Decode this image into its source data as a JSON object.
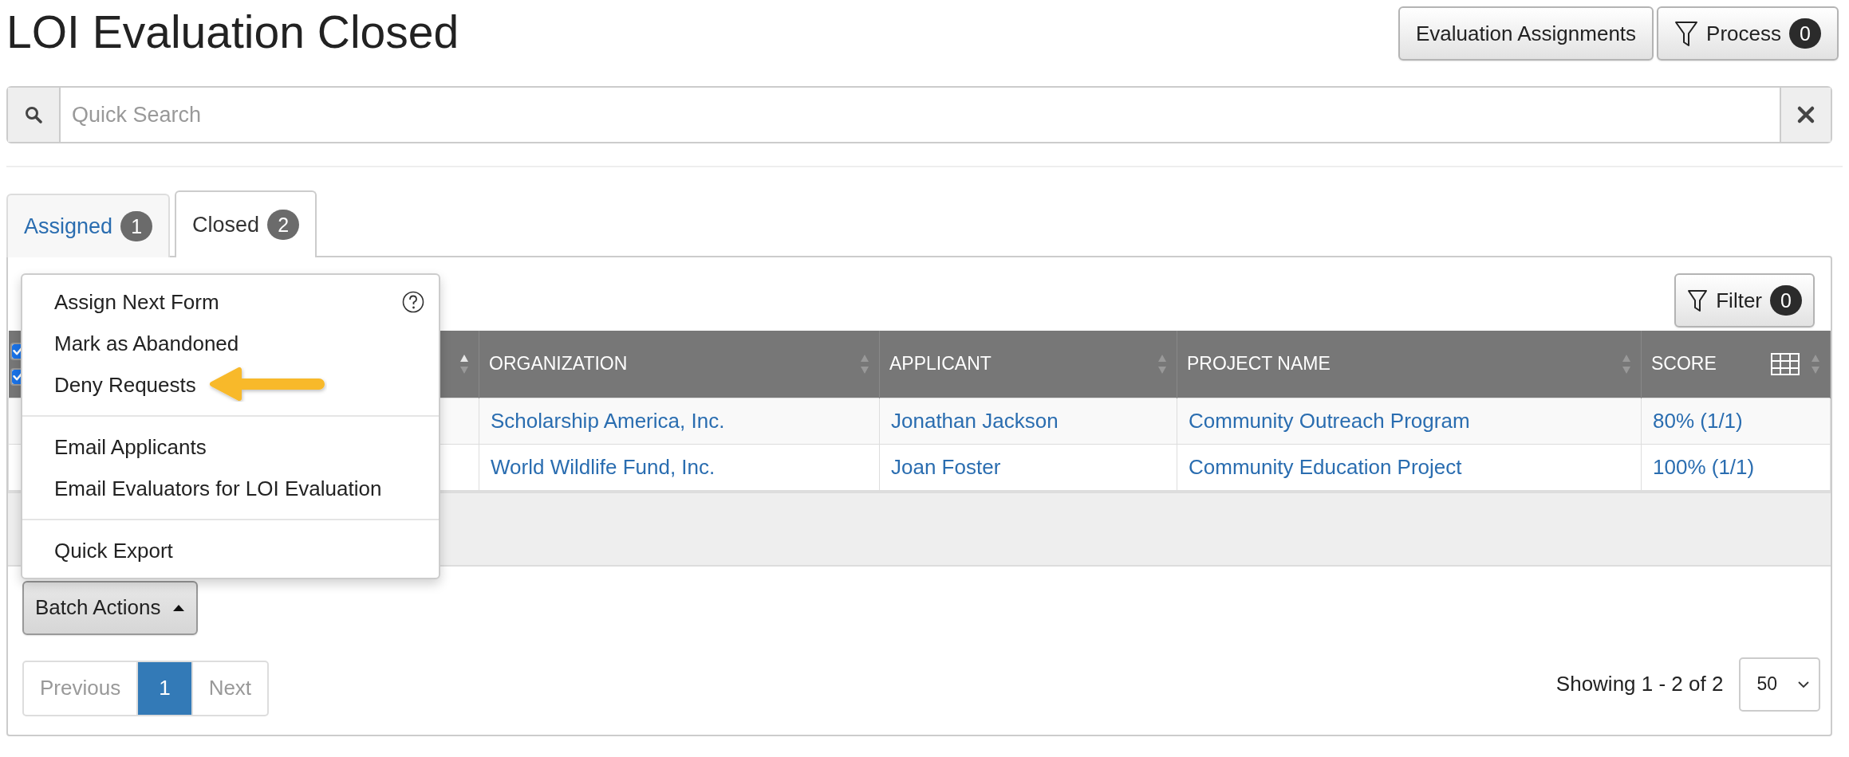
{
  "page_title": "LOI Evaluation Closed",
  "header_buttons": [
    {
      "kind": "plain",
      "label": "Evaluation Assignments"
    },
    {
      "kind": "filter",
      "label": "Process",
      "count": "0"
    }
  ],
  "search": {
    "placeholder": "Quick Search"
  },
  "tabs": [
    {
      "label": "Assigned",
      "count": "1",
      "selected": false
    },
    {
      "label": "Closed",
      "count": "2",
      "selected": true
    }
  ],
  "filter_button": {
    "label": "Filter",
    "count": "0"
  },
  "table": {
    "header_checkboxes": [
      {
        "checked": true
      },
      {
        "checked": true
      }
    ],
    "columns": [
      {
        "sorted_ascending": true
      },
      {
        "label": "ORGANIZATION",
        "sorted_ascending": false
      },
      {
        "label": "APPLICANT",
        "sorted_ascending": false
      },
      {
        "label": "PROJECT NAME",
        "sorted_ascending": false
      },
      {
        "label": "SCORE",
        "sorted_ascending": false
      }
    ],
    "column_picker": true,
    "rows": [
      {
        "organization": "Scholarship America, Inc.",
        "applicant": "Jonathan Jackson",
        "project_name": "Community Outreach Program",
        "score": "80% (1/1)"
      },
      {
        "organization": "World Wildlife Fund, Inc.",
        "applicant": "Joan Foster",
        "project_name": "Community Education Project",
        "score": "100% (1/1)"
      }
    ]
  },
  "batch_menu": {
    "open": true,
    "groups": [
      [
        {
          "label": "Assign Next Form",
          "help": true,
          "arrow": false
        },
        {
          "label": "Mark as Abandoned",
          "help": false,
          "arrow": false
        },
        {
          "label": "Deny Requests",
          "help": false,
          "arrow": true
        }
      ],
      [
        {
          "label": "Email Applicants",
          "help": false,
          "arrow": false
        },
        {
          "label": "Email Evaluators for LOI Evaluation",
          "help": false,
          "arrow": false
        }
      ],
      [
        {
          "label": "Quick Export",
          "help": false,
          "arrow": false
        }
      ]
    ]
  },
  "batch_button": {
    "label": "Batch Actions"
  },
  "pagination": {
    "previous": {
      "label": "Previous",
      "disabled": true
    },
    "pages": [
      {
        "label": "1",
        "selected": true
      }
    ],
    "next": {
      "label": "Next",
      "disabled": true
    }
  },
  "showing": "Showing 1 - 2 of 2",
  "page_size": "50"
}
